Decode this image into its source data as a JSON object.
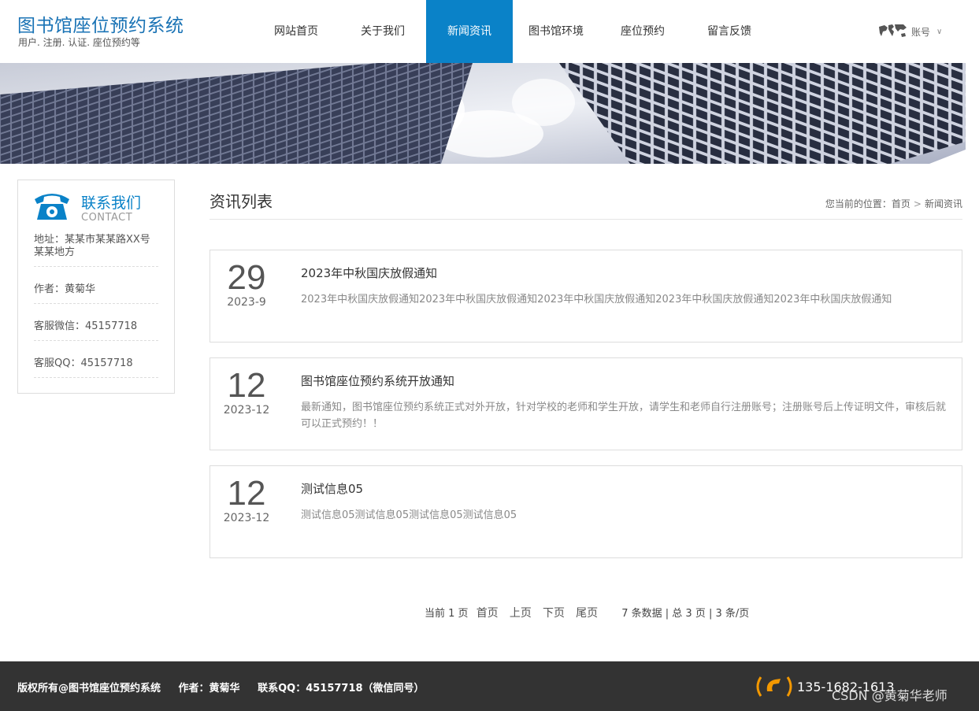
{
  "header": {
    "title": "图书馆座位预约系统",
    "subtitle": "用户. 注册. 认证. 座位预约等",
    "nav": [
      "网站首页",
      "关于我们",
      "新闻资讯",
      "图书馆环境",
      "座位预约",
      "留言反馈"
    ],
    "active_nav": "新闻资讯",
    "account_label": "账号"
  },
  "contact": {
    "title": "联系我们",
    "title_en": "CONTACT",
    "address": "地址：某某市某某路XX号某某地方",
    "author": "作者：黄菊华",
    "wechat": "客服微信：45157718",
    "qq": "客服QQ：45157718"
  },
  "main": {
    "title": "资讯列表",
    "breadcrumb_prefix": "您当前的位置：",
    "breadcrumb_home": "首页",
    "breadcrumb_sep": ">",
    "breadcrumb_current": "新闻资讯"
  },
  "news": [
    {
      "day": "29",
      "ym": "2023-9",
      "title": "2023年中秋国庆放假通知",
      "desc": "2023年中秋国庆放假通知2023年中秋国庆放假通知2023年中秋国庆放假通知2023年中秋国庆放假通知2023年中秋国庆放假通知"
    },
    {
      "day": "12",
      "ym": "2023-12",
      "title": "图书馆座位预约系统开放通知",
      "desc": "最新通知，图书馆座位预约系统正式对外开放，针对学校的老师和学生开放，请学生和老师自行注册账号；注册账号后上传证明文件，审核后就可以正式预约！！"
    },
    {
      "day": "12",
      "ym": "2023-12",
      "title": "测试信息05",
      "desc": "测试信息05测试信息05测试信息05测试信息05"
    }
  ],
  "pager": {
    "current": "当前 1 页",
    "first": "首页",
    "prev": "上页",
    "next": "下页",
    "last": "尾页",
    "summary": "7 条数据 | 总 3 页 | 3 条/页"
  },
  "footer": {
    "copyright": "版权所有@图书馆座位预约系统",
    "author": "作者：黄菊华",
    "qq": "联系QQ：45157718（微信同号）",
    "phone": "135-1682-1613"
  },
  "watermark": "CSDN @黄菊华老师",
  "colors": {
    "accent": "#0a82c8",
    "footer_bg": "#333333",
    "phone_accent": "#f39800"
  }
}
